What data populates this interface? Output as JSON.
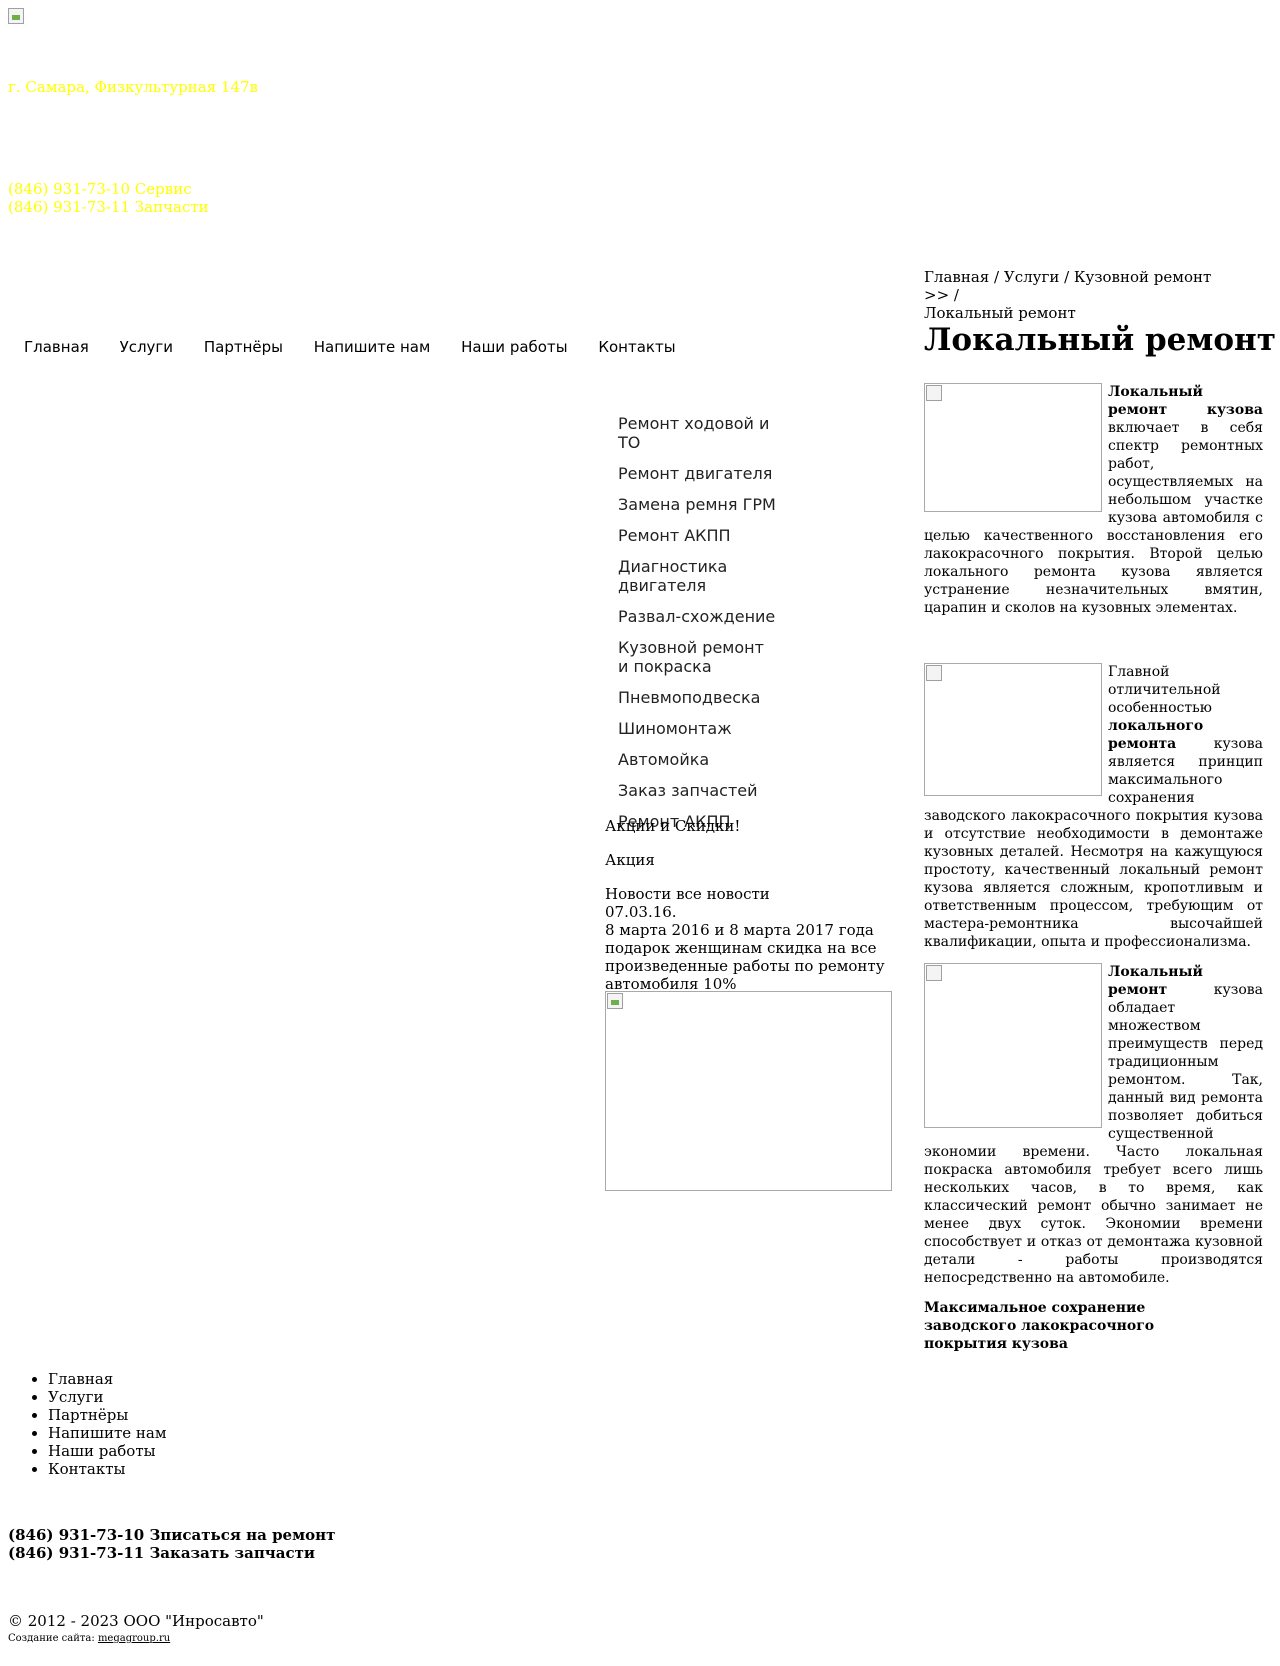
{
  "header": {
    "address": "г. Самара, Физкультурная 147в",
    "phone_service": "(846) 931-73-10 Сервис",
    "phone_parts": "(846) 931-73-11 Запчасти"
  },
  "top_nav": [
    "Главная",
    "Услуги",
    "Партнёры",
    "Напишите нам",
    "Наши работы",
    "Контакты"
  ],
  "breadcrumb": {
    "home": "Главная",
    "sep": " / ",
    "services": "Услуги",
    "body_repair": "Кузовной ремонт >>",
    "current": "Локальный ремонт"
  },
  "page_title": "Локальный ремонт",
  "services_menu": [
    "Ремонт ходовой и ТО",
    "Ремонт двигателя",
    "Замена ремня ГРМ",
    "Ремонт АКПП",
    "Диагностика двигателя",
    "Развал-схождение",
    "Кузовной ремонт и покраска",
    "Пневмоподвеска",
    "Шиномонтаж",
    "Автомойка",
    "Заказ запчастей",
    "Ремонт АКПП"
  ],
  "sidebar": {
    "promo_heading": "Акции и Скидки!",
    "promo_item": "Акция",
    "news_label": "Новости",
    "all_news": "все новости",
    "news_date": "07.03.16.",
    "news_text": "8 марта 2016 и 8 марта 2017 года подарок женщинам скидка на все произведенные работы по ремонту автомобиля 10%"
  },
  "article": {
    "p1_bold": "Локальный ремонт кузова",
    "p1_rest": " включает в себя спектр ремонтных работ, осуществляемых на небольшом участке кузова автомобиля с целью качественного восстановления его лакокрасочного покрытия. Второй целью локального ремонта кузова является устранение незначительных вмятин, царапин и сколов на кузовных элементах.",
    "p2_start": "Главной отличительной особенностью ",
    "p2_bold": "локального ремонта",
    "p2_rest": " кузова является принцип максимального сохранения заводского лакокрасочного покрытия кузова и отсутствие необходимости в демонтаже кузовных деталей. Несмотря на кажущуюся простоту, качественный локальный ремонт кузова является сложным, кропотливым и ответственным процессом, требующим от мастера-ремонтника высочайшей квалификации, опыта и профессионализма.",
    "p3_bold": "Локальный ремонт",
    "p3_rest": " кузова обладает множеством преимуществ перед традиционным ремонтом. Так, данный вид ремонта позволяет добиться существенной экономии времени. Часто локальная покраска автомобиля требует всего лишь нескольких часов, в то время, как классический ремонт обычно занимает не менее двух суток. Экономии времени способствует и отказ от демонтажа кузовной детали - работы производятся непосредственно на автомобиле.",
    "subheading": "Максимальное сохранение заводского лакокрасочного покрытия кузова"
  },
  "footer": {
    "nav": [
      "Главная",
      "Услуги",
      "Партнёры",
      "Напишите нам",
      "Наши работы",
      "Контакты"
    ],
    "phone1": "(846) 931-73-10 Зписаться на ремонт",
    "phone2": "(846) 931-73-11 Заказать запчасти",
    "copyright": "© 2012 - 2023 ООО \"Инросавто\"",
    "credit_label": "Создание сайта:",
    "credit_link": "megagroup.ru"
  },
  "colors": {
    "header_text": "#ffff00"
  },
  "icons": {
    "logo": "broken-image-icon"
  }
}
